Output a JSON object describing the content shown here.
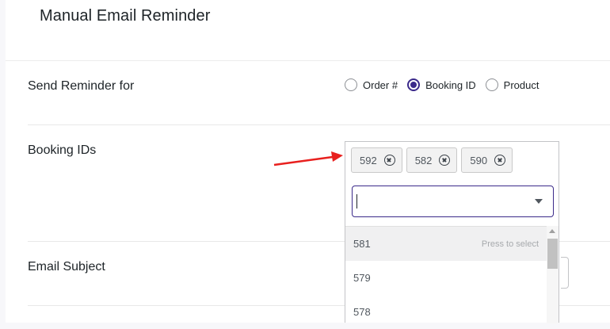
{
  "header": {
    "title": "Manual Email Reminder"
  },
  "send_reminder": {
    "label": "Send Reminder for",
    "options": [
      {
        "label": "Order #",
        "checked": false
      },
      {
        "label": "Booking ID",
        "checked": true
      },
      {
        "label": "Product",
        "checked": false
      }
    ]
  },
  "booking_ids": {
    "label": "Booking IDs",
    "selected": [
      "592",
      "582",
      "590"
    ],
    "search_value": "",
    "dropdown_options": [
      {
        "value": "581",
        "hint": "Press to select"
      },
      {
        "value": "579"
      },
      {
        "value": "578"
      }
    ]
  },
  "email_subject": {
    "label": "Email Subject"
  },
  "colors": {
    "accent": "#3b2a8a",
    "annotation_arrow": "#e8201e"
  }
}
